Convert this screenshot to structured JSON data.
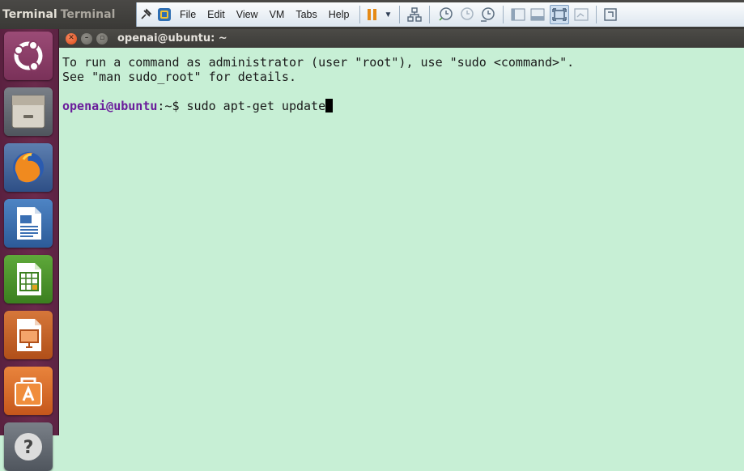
{
  "topbar": {
    "app_title_left": "Terminal",
    "app_title_right": "Terminal"
  },
  "vm_toolbar": {
    "menus": [
      "File",
      "Edit",
      "View",
      "VM",
      "Tabs",
      "Help"
    ],
    "icons": [
      "pin-icon",
      "vm-console-icon",
      "pause-icon",
      "dropdown-arrow-icon",
      "network-icon",
      "snapshot-take-icon",
      "snapshot-revert-icon",
      "snapshot-manager-icon",
      "view-console-icon",
      "view-unity-icon",
      "full-screen-icon",
      "quick-switch-icon",
      "fit-guest-icon"
    ]
  },
  "launcher": {
    "items": [
      "ubuntu-dash-icon",
      "files-icon",
      "firefox-icon",
      "libreoffice-writer-icon",
      "libreoffice-calc-icon",
      "libreoffice-impress-icon",
      "software-center-icon",
      "help-icon"
    ]
  },
  "terminal": {
    "title": "openai@ubuntu: ~",
    "lines": [
      "To run a command as administrator (user \"root\"), use \"sudo <command>\".",
      "See \"man sudo_root\" for details."
    ],
    "prompt_user": "openai@ubuntu",
    "prompt_path": ":~$ ",
    "command": "sudo apt-get update"
  },
  "colors": {
    "terminal_bg": "#c7efd5",
    "prompt_user": "#6a1d9b",
    "launcher_bg": "#6b2a4c",
    "close_button": "#dd4814"
  }
}
